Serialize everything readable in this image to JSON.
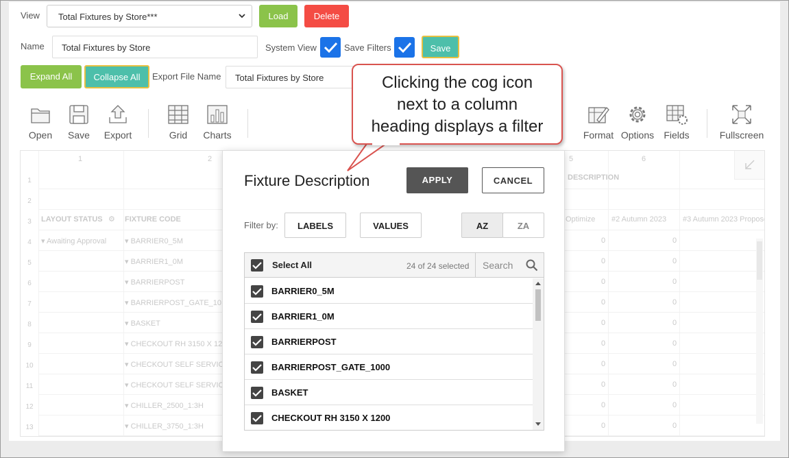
{
  "view": {
    "label": "View",
    "selected": "Total Fixtures by Store***"
  },
  "buttons": {
    "load": "Load",
    "delete": "Delete",
    "save": "Save",
    "expand_all": "Expand All",
    "collapse_all": "Collapse All"
  },
  "name": {
    "label": "Name",
    "value": "Total Fixtures by Store"
  },
  "system_view": {
    "label": "System View",
    "checked": true
  },
  "save_filters": {
    "label": "Save Filters",
    "checked": true
  },
  "export": {
    "label": "Export File Name",
    "value": "Total Fixtures by Store"
  },
  "toolbar": {
    "open": "Open",
    "save": "Save",
    "export": "Export",
    "grid": "Grid",
    "charts": "Charts",
    "format": "Format",
    "options": "Options",
    "fields": "Fields",
    "fullscreen": "Fullscreen"
  },
  "grid": {
    "col_numbers": [
      "1",
      "2",
      "5",
      "6"
    ],
    "row_numbers": [
      "1",
      "2",
      "3",
      "4",
      "5",
      "6",
      "7",
      "8",
      "9",
      "10",
      "11",
      "12",
      "13"
    ],
    "headers": {
      "layout_status": "LAYOUT STATUS",
      "fixture_code": "FIXTURE CODE",
      "description": "DESCRIPTION",
      "optimize": "Optimize",
      "autumn_2": "#2 Autumn 2023",
      "autumn_3": "#3 Autumn 2023 Propose"
    },
    "status_value": "Awaiting Approval",
    "codes": [
      "BARRIER0_5M",
      "BARRIER1_0M",
      "BARRIERPOST",
      "BARRIERPOST_GATE_10",
      "BASKET",
      "CHECKOUT RH 3150 X 12",
      "CHECKOUT SELF SERVIC",
      "CHECKOUT SELF SERVIC",
      "CHILLER_2500_1:3H",
      "CHILLER_3750_1:3H"
    ],
    "zeros": [
      "0",
      "0",
      "0",
      "0",
      "0",
      "0",
      "0",
      "0",
      "0",
      "0"
    ]
  },
  "filter_popup": {
    "title": "Fixture Description",
    "apply": "APPLY",
    "cancel": "CANCEL",
    "filter_by_label": "Filter by:",
    "labels_btn": "LABELS",
    "values_btn": "VALUES",
    "sort_az": "AZ",
    "sort_za": "ZA",
    "select_all": "Select All",
    "selected_count": "24 of 24 selected",
    "search_placeholder": "Search",
    "items": [
      "BARRIER0_5M",
      "BARRIER1_0M",
      "BARRIERPOST",
      "BARRIERPOST_GATE_1000",
      "BASKET",
      "CHECKOUT RH 3150 X 1200"
    ]
  },
  "callout": {
    "line1": "Clicking the cog icon",
    "line2": "next to a column",
    "line3": "heading displays a filter"
  },
  "colors": {
    "green": "#8bc34a",
    "red": "#f44c44",
    "teal": "#4dbfaa",
    "checkbox_blue": "#1b73e8",
    "dark_button": "#555555",
    "callout_border": "#d9534f"
  }
}
